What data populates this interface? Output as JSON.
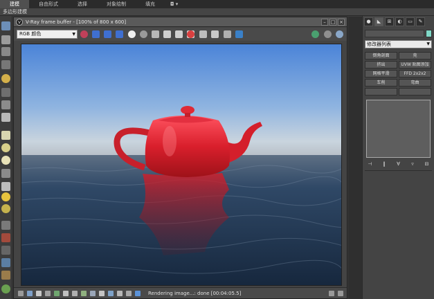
{
  "ribbon": {
    "tabs": [
      "建模",
      "自由形式",
      "选择",
      "对象绘制",
      "填充"
    ],
    "more": "◘ ▾"
  },
  "subbar": {
    "label": "多边形建模"
  },
  "vfb": {
    "title": "V-Ray frame buffer - [100% of 800 x 600]",
    "channel": "RGB 颜色",
    "status": "Rendering image...: done [00:04:05.5]"
  },
  "command_panel": {
    "modifier_list": "修改器列表",
    "buttons": [
      [
        "倒角剖面",
        "壳"
      ],
      [
        "挤出",
        "UVW 贴图添加"
      ],
      [
        "网格平滑",
        "FFD 2x2x2"
      ],
      [
        "车削",
        "弯曲"
      ]
    ]
  },
  "colors": {
    "window_bg": "#444444",
    "accent_chip": "#7fd8c7",
    "teapot": "#d01f2a",
    "sky_top": "#4f86d8",
    "sea": "#1e3550"
  }
}
